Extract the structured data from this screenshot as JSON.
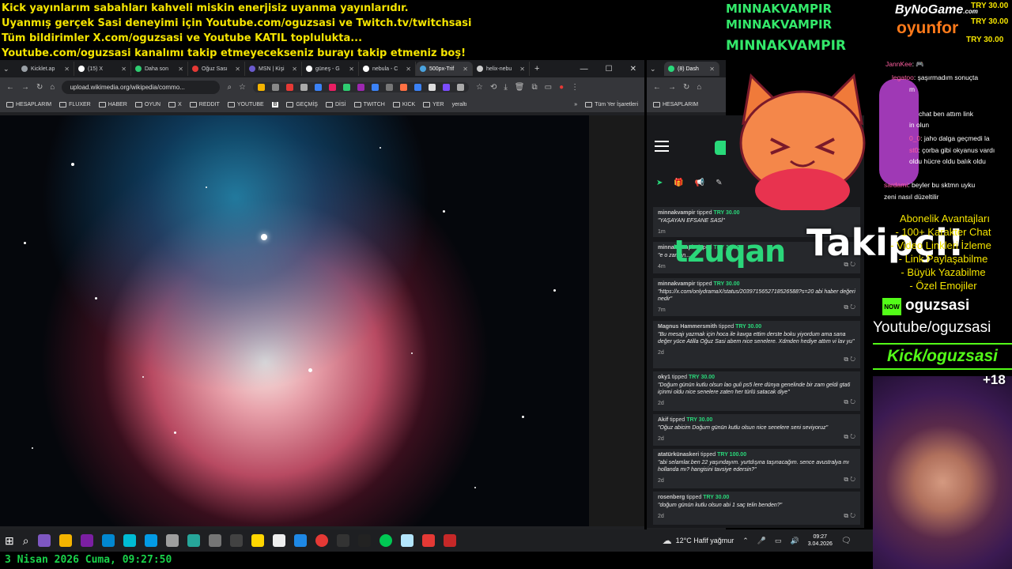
{
  "banner": [
    "Kick yayınlarım sabahları kahveli miskin enerjisiz uyanma yayınlarıdır.",
    "Uyanmış gerçek Sasi deneyimi için Youtube.com/oguzsasi ve Twitch.tv/twitchsasi",
    "Tüm bildirimler X.com/oguzsasi ve Youtube KATIL toplulukta...",
    "Youtube.com/oguzsasi kanalımı takip etmeyecekseniz burayı takip etmeniz boş!"
  ],
  "browser1": {
    "tabs": [
      "Kicklet.ap",
      "(15) X",
      "Daha son",
      "Oğuz Sası",
      "MSN | Kişi",
      "güneş - G",
      "nebula - C",
      "500px-Trif",
      "helix-nebu"
    ],
    "url": "upload.wikimedia.org/wikipedia/commo...",
    "bookmarks": [
      "HESAPLARIM",
      "FLUXER",
      "HABER",
      "OYUN",
      "X",
      "REDDIT",
      "YOUTUBE",
      "B",
      "GEÇMİŞ",
      "DİSİ",
      "TWITCH",
      "KICK",
      "YER",
      "yeraltı"
    ],
    "all_bookmarks": "Tüm Yer İşaretleri"
  },
  "browser2": {
    "tab": "(8) Dash",
    "bookmark": "HESAPLARIM"
  },
  "tips": [
    {
      "user": "minnakvampir",
      "verb": "tipped",
      "amount": "TRY 30.00",
      "message": "\"YAŞAYAN EFSANE SASİ\"",
      "age": "1m"
    },
    {
      "user": "minnakvampir",
      "verb": "tipped",
      "amount": "TRY 30.00",
      "message": "\"e o zaman...",
      "age": "4m"
    },
    {
      "user": "minnakvampir",
      "verb": "tipped",
      "amount": "TRY 30.00",
      "message": "\"https://x.com/onlydramaX/status/2039715652718526588?s=20 abi haber değeri nedir\"",
      "age": "7m"
    },
    {
      "user": "Magnus Hammersmith",
      "verb": "tipped",
      "amount": "TRY 30.00",
      "message": "\"Bu mesajı yazmak için hoca ile kavga ettim derste boku yiyordum ama sana değer yüce Atilla Oğuz Sasi abem nice senelere. Xdmden hediye attım vi lav yu\"",
      "age": "2d"
    },
    {
      "user": "oky1",
      "verb": "tipped",
      "amount": "TRY 30.00",
      "message": "\"Doğum günün kutlu olsun lao guli ps5 lere dünya genelinde bir zam geldi gta6 içinmi oldu nice senelere zaten her türlü satacak diye\"",
      "age": "2d"
    },
    {
      "user": "Akif",
      "verb": "tipped",
      "amount": "TRY 30.00",
      "message": "\"Oğuz abicim Doğum günün kutlu olsun nice senelere seni seviyoruz\"",
      "age": "2d"
    },
    {
      "user": "atatürkünaskeri",
      "verb": "tipped",
      "amount": "TRY 100.00",
      "message": "\"abi selamlar.ben 22 yaşındayım. yurtdışına taşınacağım. sence avustralya mı hollanda mı? hangisini tavsiye edersin?\"",
      "age": "2d"
    },
    {
      "user": "rosenberg",
      "verb": "tipped",
      "amount": "TRY 30.00",
      "message": "\"doğum günün kutlu olsun abi 1 saç telin benden?\"",
      "age": "2d"
    }
  ],
  "overlay": {
    "supporters": [
      "MINNAKVAMPIR",
      "MINNAKVAMPIR",
      "MINNAKVAMPIR"
    ],
    "sponsor_top": "ByNoGame",
    "sponsor_com": ".com",
    "sponsor_bottom": "oyunfor",
    "donations": [
      "TRY 30.00",
      "TRY 30.00",
      "TRY 30.00"
    ],
    "chat": [
      {
        "user": "JannKee",
        "text": ": 🎮"
      },
      {
        "user": "legatoo",
        "text": ": şaşırmadım sonuçta"
      },
      {
        "user": "",
        "text": "m"
      },
      {
        "user": "",
        "text": "chat ben attım link"
      },
      {
        "user": "",
        "text": "in olun"
      },
      {
        "user": "0_0",
        "text": ": jaho dalga geçmedi la"
      },
      {
        "user": "st0",
        "text": ": çorba gibi okyanus vardı"
      },
      {
        "user": "",
        "text": "oldu hücre oldu balık oldu"
      },
      {
        "user": "sardami",
        "text": ": beyler bu sktmn uyku"
      },
      {
        "user": "",
        "text": "zeni nasıl düzeltilir"
      }
    ],
    "alert_name": "tzuqan",
    "alert_text": "Takipçi!",
    "perks_title": "Abonelik Avantajları",
    "perks": [
      "- 100+ Karakter Chat",
      "- Video Linkleri İzleme",
      "- Link Paylaşabilme",
      "- Büyük Yazabilme",
      "- Özel Emojiler"
    ],
    "kick_badge": "NOW",
    "kick_user": "oguzsasi",
    "youtube": "Youtube/oguzsasi",
    "kick_link": "Kick/oguzsasi",
    "age_rating": "+18"
  },
  "taskbar": {
    "weather": "12°C  Hafif yağmur",
    "time": "09:27",
    "date": "3.04.2026"
  },
  "footer_date": "3 Nisan 2026 Cuma, 09:27:50"
}
